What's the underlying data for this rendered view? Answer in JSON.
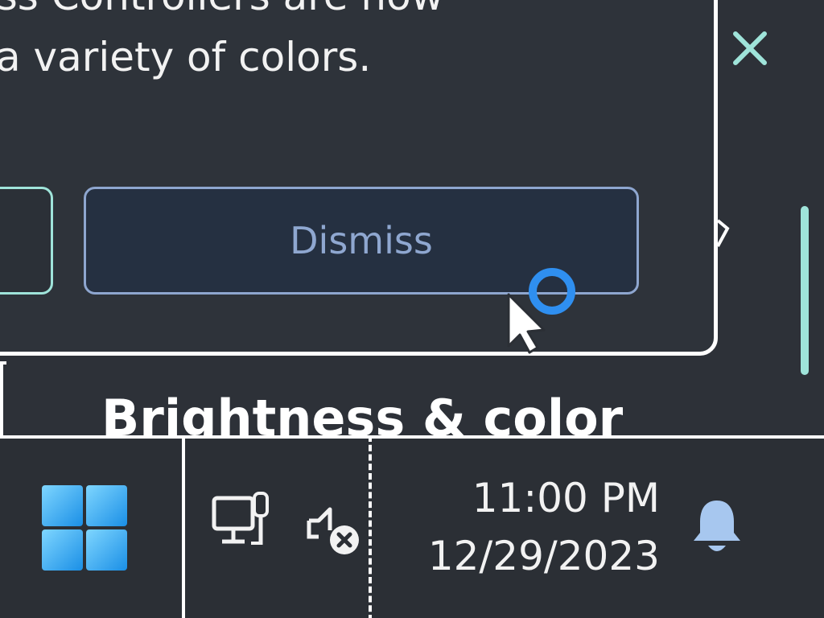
{
  "notification": {
    "line1": "ess Controllers are now",
    "line2": "a variety of colors.",
    "dismiss_label": "Dismiss",
    "close_icon": "close-icon"
  },
  "settings": {
    "heading": "Brightness & color"
  },
  "taskbar": {
    "start_icon": "windows-logo-icon",
    "tray_icons": [
      "network-icon",
      "volume-muted-icon"
    ],
    "time": "11:00 PM",
    "date": "12/29/2023",
    "notification_icon": "bell-icon"
  },
  "colors": {
    "accent_teal": "#9fe4da",
    "dismiss_text": "#8fa7d0",
    "start_blue": "#2fa8ea",
    "bell_blue": "#a7c7ef",
    "cursor_ring": "#2f8ff0"
  }
}
